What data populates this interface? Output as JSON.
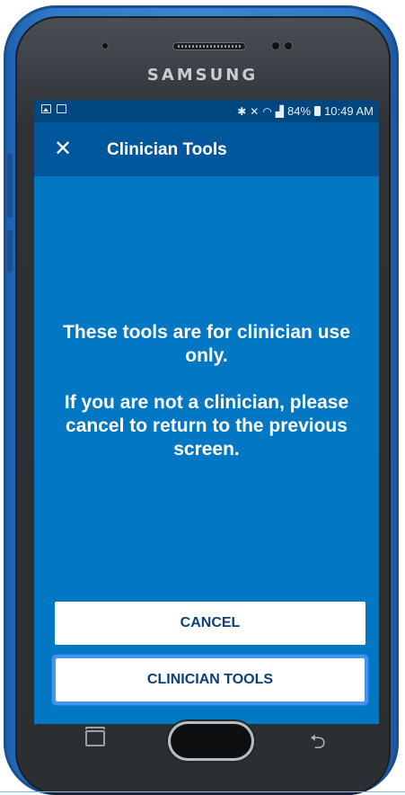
{
  "device": {
    "brand": "SAMSUNG"
  },
  "status_bar": {
    "left_icons": [
      "image-icon",
      "card-icon"
    ],
    "right_icons": [
      "bluetooth-icon",
      "mute-icon",
      "wifi-icon",
      "signal-icon",
      "battery-icon"
    ],
    "battery_percent": "84%",
    "time": "10:49 AM"
  },
  "app_bar": {
    "close_glyph": "✕",
    "title": "Clinician Tools"
  },
  "message": {
    "line1": "These tools are for clinician use only.",
    "line2": "If you are not a clinician, please cancel to return to the previous screen."
  },
  "buttons": {
    "cancel": "CANCEL",
    "clinician_tools": "CLINICIAN TOOLS"
  },
  "colors": {
    "accent_blue": "#0277c4",
    "appbar_blue": "#01579b",
    "statusbar_blue": "#01467f",
    "case_blue": "#3b86d2",
    "focus_outline": "#3f95f0",
    "button_text": "#0d3f73"
  }
}
